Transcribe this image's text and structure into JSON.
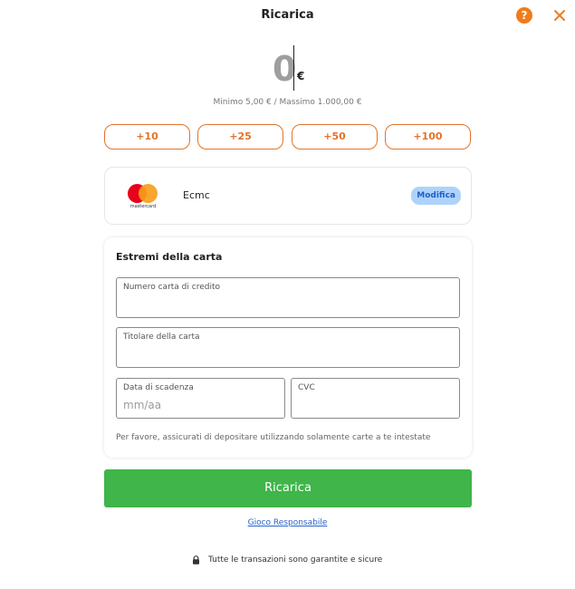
{
  "header": {
    "title": "Ricarica",
    "help_icon_glyph": "?",
    "help_icon": "question-circle-icon",
    "close_icon": "close-icon",
    "accent_color": "#f07c1c"
  },
  "amount": {
    "value": "0",
    "currency": "€",
    "limits": "Minimo 5,00 € / Massimo 1.000,00 €"
  },
  "quick_amounts": [
    "+10",
    "+25",
    "+50",
    "+100"
  ],
  "payment_method": {
    "logo_text": "mastercard",
    "name": "Ecmc",
    "modify_label": "Modifica"
  },
  "card_details": {
    "title": "Estremi della carta",
    "card_number_label": "Numero carta di credito",
    "holder_label": "Titolare della carta",
    "expiry_label": "Data di scadenza",
    "expiry_placeholder": "mm/aa",
    "cvc_label": "CVC",
    "note": "Per favore, assicurati di depositare utilizzando solamente carte a te intestate"
  },
  "actions": {
    "submit_label": "Ricarica",
    "submit_color": "#3fb54a",
    "responsible_link": "Gioco Responsabile"
  },
  "footer": {
    "lock_icon": "lock-icon",
    "secure_text": "Tutte le transazioni sono garantite e sicure"
  }
}
